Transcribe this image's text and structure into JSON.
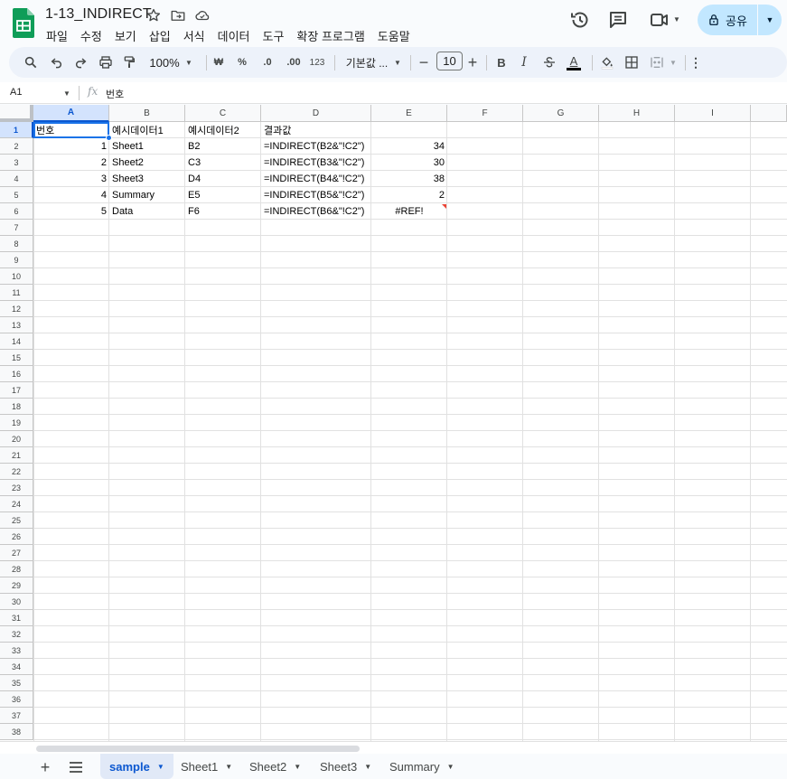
{
  "app": {
    "doc_title": "1-13_INDIRECT",
    "menu": [
      "파일",
      "수정",
      "보기",
      "삽입",
      "서식",
      "데이터",
      "도구",
      "확장 프로그램",
      "도움말"
    ],
    "share_label": "공유"
  },
  "toolbar": {
    "zoom": "100%",
    "currency": "₩",
    "percent": "%",
    "dec_decrease": ".0",
    "dec_increase": ".00",
    "number_format": "123",
    "font_name": "기본값 ...",
    "font_size": "10",
    "bold": "B",
    "italic": "I",
    "text_color": "A"
  },
  "formula_bar": {
    "cell_ref": "A1",
    "fx": "fx",
    "content": "번호"
  },
  "grid": {
    "columns": [
      "A",
      "B",
      "C",
      "D",
      "E",
      "F",
      "G",
      "H",
      "I"
    ],
    "rows": [
      "1",
      "2",
      "3",
      "4",
      "5",
      "6",
      "7",
      "8",
      "9",
      "10",
      "11",
      "12",
      "13",
      "14",
      "15",
      "16",
      "17",
      "18",
      "19",
      "20",
      "21",
      "22",
      "23",
      "24",
      "25",
      "26",
      "27",
      "28",
      "29",
      "30",
      "31",
      "32",
      "33",
      "34",
      "35",
      "36",
      "37",
      "38"
    ],
    "data": [
      [
        "번호",
        "예시데이터1",
        "예시데이터2",
        "결과값",
        ""
      ],
      [
        "1",
        "Sheet1",
        "B2",
        "=INDIRECT(B2&\"!C2\")",
        "34"
      ],
      [
        "2",
        "Sheet2",
        "C3",
        "=INDIRECT(B3&\"!C2\")",
        "30"
      ],
      [
        "3",
        "Sheet3",
        "D4",
        "=INDIRECT(B4&\"!C2\")",
        "38"
      ],
      [
        "4",
        "Summary",
        "E5",
        "=INDIRECT(B5&\"!C2\")",
        "2"
      ],
      [
        "5",
        "Data",
        "F6",
        "=INDIRECT(B6&\"!C2\")",
        "#REF!"
      ]
    ]
  },
  "sheets": {
    "tabs": [
      "sample",
      "Sheet1",
      "Sheet2",
      "Sheet3",
      "Summary"
    ],
    "active": "sample"
  }
}
